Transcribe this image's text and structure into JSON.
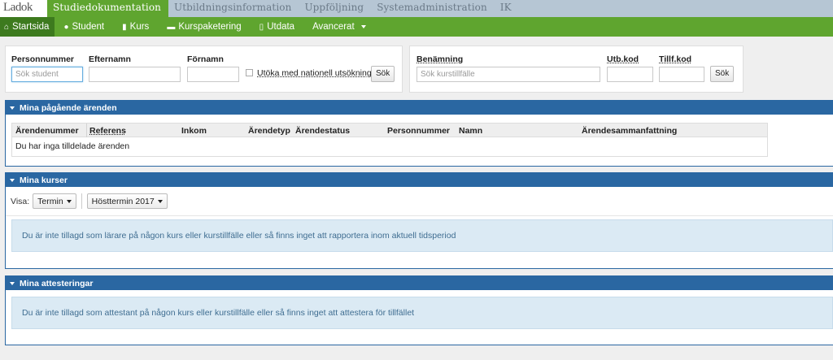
{
  "topbar": {
    "logo": "Ladok",
    "tabs": [
      "Studiedokumentation",
      "Utbildningsinformation",
      "Uppföljning",
      "Systemadministration",
      "IK"
    ]
  },
  "nav": {
    "start": "Startsida",
    "student": "Student",
    "kurs": "Kurs",
    "kurspaketering": "Kurspaketering",
    "utdata": "Utdata",
    "avancerat": "Avancerat"
  },
  "student_search": {
    "personnummer_label": "Personnummer",
    "personnummer_placeholder": "Sök student",
    "efternamn_label": "Efternamn",
    "fornamn_label": "Förnamn",
    "national_label": "Utöka med nationell utsökning",
    "button": "Sök"
  },
  "course_search": {
    "benamning_label": "Benämning",
    "benamning_placeholder": "Sök kurstillfälle",
    "utbkod_label": "Utb.kod",
    "tillfkod_label": "Tillf.kod",
    "button": "Sök"
  },
  "arenden": {
    "title": "Mina pågående ärenden",
    "columns": [
      "Ärendenummer",
      "Referens",
      "Inkom",
      "Ärendetyp",
      "Ärendestatus",
      "Personnummer",
      "Namn",
      "Ärendesammanfattning"
    ],
    "empty": "Du har inga tilldelade ärenden"
  },
  "kurser": {
    "title": "Mina kurser",
    "visa_label": "Visa:",
    "filter1": "Termin",
    "filter2": "Hösttermin 2017",
    "message": "Du är inte tillagd som lärare på någon kurs eller kurstillfälle eller så finns inget att rapportera inom aktuell tidsperiod"
  },
  "attesteringar": {
    "title": "Mina attesteringar",
    "message": "Du är inte tillagd som attestant på någon kurs eller kurstillfälle eller så finns inget att attestera för tillfället"
  },
  "colors": {
    "green": "#5fa52f",
    "dark_green": "#3d7a1e",
    "panel_blue": "#2a67a2",
    "info_bg": "#dbeaf4"
  }
}
